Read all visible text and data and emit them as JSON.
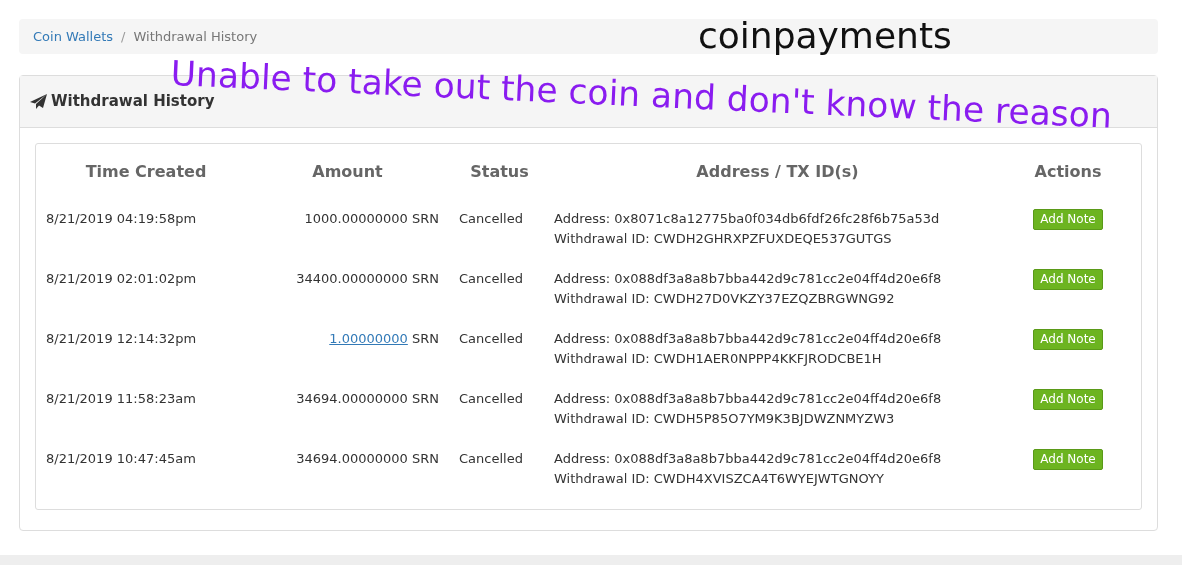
{
  "breadcrumb": [
    {
      "label": "Coin Wallets",
      "link": true
    },
    {
      "label": "Withdrawal History",
      "link": false
    }
  ],
  "breadcrumb_separator": "/",
  "overlay_notes": {
    "brand": "coinpayments",
    "complaint": "Unable to take out the coin and don't know the reason"
  },
  "panel": {
    "title": "Withdrawal History"
  },
  "table": {
    "columns": [
      "Time Created",
      "Amount",
      "Status",
      "Address / TX ID(s)",
      "Actions"
    ],
    "rows": [
      {
        "time": "8/21/2019 04:19:58pm",
        "amount": {
          "value": "1000.00000000",
          "unit": "SRN",
          "link": false
        },
        "status": "Cancelled",
        "address": "Address: 0x8071c8a12775ba0f034db6fdf26fc28f6b75a53d",
        "withdrawal_id": "Withdrawal ID: CWDH2GHRXPZFUXDEQE537GUTGS",
        "action": "Add Note"
      },
      {
        "time": "8/21/2019 02:01:02pm",
        "amount": {
          "value": "34400.00000000",
          "unit": "SRN",
          "link": false
        },
        "status": "Cancelled",
        "address": "Address: 0x088df3a8a8b7bba442d9c781cc2e04ff4d20e6f8",
        "withdrawal_id": "Withdrawal ID: CWDH27D0VKZY37EZQZBRGWNG92",
        "action": "Add Note"
      },
      {
        "time": "8/21/2019 12:14:32pm",
        "amount": {
          "value": "1.00000000",
          "unit": "SRN",
          "link": true
        },
        "status": "Cancelled",
        "address": "Address: 0x088df3a8a8b7bba442d9c781cc2e04ff4d20e6f8",
        "withdrawal_id": "Withdrawal ID: CWDH1AER0NPPP4KKFJRODCBE1H",
        "action": "Add Note"
      },
      {
        "time": "8/21/2019 11:58:23am",
        "amount": {
          "value": "34694.00000000",
          "unit": "SRN",
          "link": false
        },
        "status": "Cancelled",
        "address": "Address: 0x088df3a8a8b7bba442d9c781cc2e04ff4d20e6f8",
        "withdrawal_id": "Withdrawal ID: CWDH5P85O7YM9K3BJDWZNMYZW3",
        "action": "Add Note"
      },
      {
        "time": "8/21/2019 10:47:45am",
        "amount": {
          "value": "34694.00000000",
          "unit": "SRN",
          "link": false
        },
        "status": "Cancelled",
        "address": "Address: 0x088df3a8a8b7bba442d9c781cc2e04ff4d20e6f8",
        "withdrawal_id": "Withdrawal ID: CWDH4XVISZCA4T6WYEJWTGNOYY",
        "action": "Add Note"
      }
    ]
  }
}
